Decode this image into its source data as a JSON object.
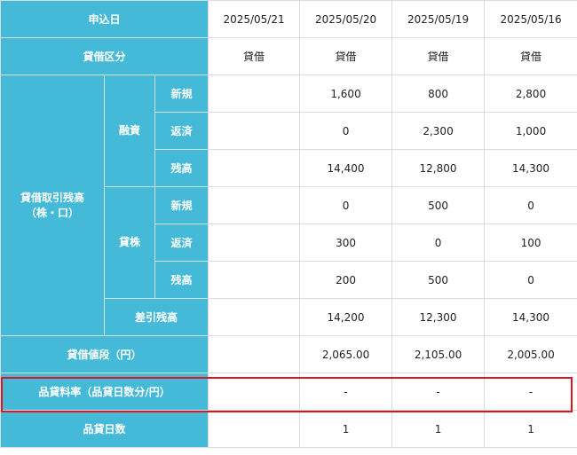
{
  "table": {
    "header_label": "申込日",
    "dates": [
      "2025/05/21",
      "2025/05/20",
      "2025/05/19",
      "2025/05/16"
    ],
    "rows": {
      "kubun": {
        "label": "貸借区分",
        "values": [
          "貸借",
          "貸借",
          "貸借",
          "貸借"
        ]
      },
      "zandaka_group": {
        "label_line1": "貸借取引残高",
        "label_line2": "（株・口）"
      },
      "yushi": {
        "label": "融資",
        "shinki": {
          "label": "新規",
          "values": [
            "",
            "1,600",
            "800",
            "2,800"
          ]
        },
        "hensai": {
          "label": "返済",
          "values": [
            "",
            "0",
            "2,300",
            "1,000"
          ]
        },
        "zandaka": {
          "label": "残高",
          "values": [
            "",
            "14,400",
            "12,800",
            "14,300"
          ]
        }
      },
      "kashikabu": {
        "label": "貸株",
        "shinki": {
          "label": "新規",
          "values": [
            "",
            "0",
            "500",
            "0"
          ]
        },
        "hensai": {
          "label": "返済",
          "values": [
            "",
            "300",
            "0",
            "100"
          ]
        },
        "zandaka": {
          "label": "残高",
          "values": [
            "",
            "200",
            "500",
            "0"
          ]
        }
      },
      "sashihiki": {
        "label": "差引残高",
        "values": [
          "",
          "14,200",
          "12,300",
          "14,300"
        ]
      },
      "nedan": {
        "label": "貸借値段（円）",
        "values": [
          "",
          "2,065.00",
          "2,105.00",
          "2,005.00"
        ]
      },
      "ryoritsu": {
        "label": "品貸料率（品貸日数分/円）",
        "values": [
          "",
          "-",
          "-",
          "-"
        ]
      },
      "nissu": {
        "label": "品貸日数",
        "values": [
          "",
          "1",
          "1",
          "1"
        ]
      }
    }
  },
  "colors": {
    "header_bg": "#44b9d8",
    "highlight_border": "#e0141e",
    "grid_line": "#d7dee2"
  }
}
